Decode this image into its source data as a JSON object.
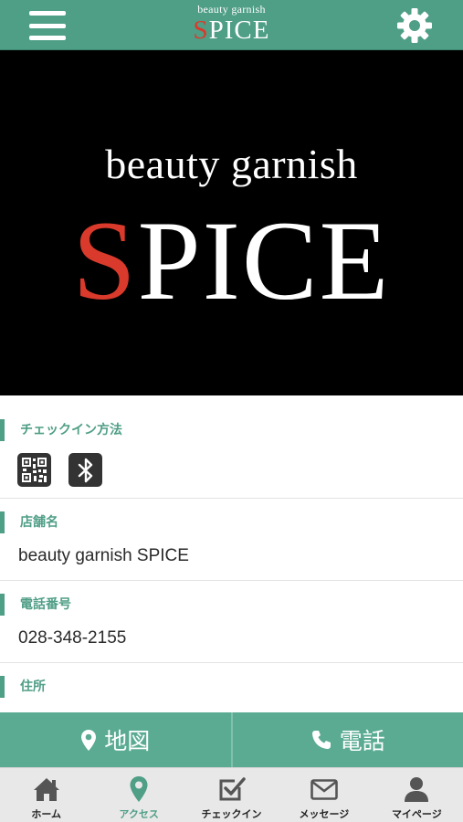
{
  "header": {
    "logo_small": "beauty garnish",
    "logo_first_letter": "S",
    "logo_rest": "PICE",
    "menu_icon": "hamburger-menu-icon",
    "settings_icon": "gear-icon"
  },
  "hero": {
    "subtitle": "beauty garnish",
    "title_first_letter": "S",
    "title_rest": "PICE"
  },
  "sections": {
    "checkin": {
      "title": "チェックイン方法",
      "icons": [
        "qr-code-icon",
        "bluetooth-icon"
      ]
    },
    "shop_name": {
      "title": "店舗名",
      "value": "beauty garnish SPICE"
    },
    "phone": {
      "title": "電話番号",
      "value": "028-348-2155"
    },
    "address": {
      "title": "住所"
    }
  },
  "actions": {
    "map_label": "地図",
    "call_label": "電話"
  },
  "tabs": [
    {
      "label": "ホーム",
      "icon": "home-icon",
      "active": false
    },
    {
      "label": "アクセス",
      "icon": "map-pin-icon",
      "active": true
    },
    {
      "label": "チェックイン",
      "icon": "checkin-icon",
      "active": false
    },
    {
      "label": "メッセージ",
      "icon": "envelope-icon",
      "active": false
    },
    {
      "label": "マイページ",
      "icon": "user-icon",
      "active": false
    }
  ],
  "colors": {
    "brand": "#4f9e86",
    "action": "#5aab92",
    "logo_accent": "#d93a2b"
  }
}
